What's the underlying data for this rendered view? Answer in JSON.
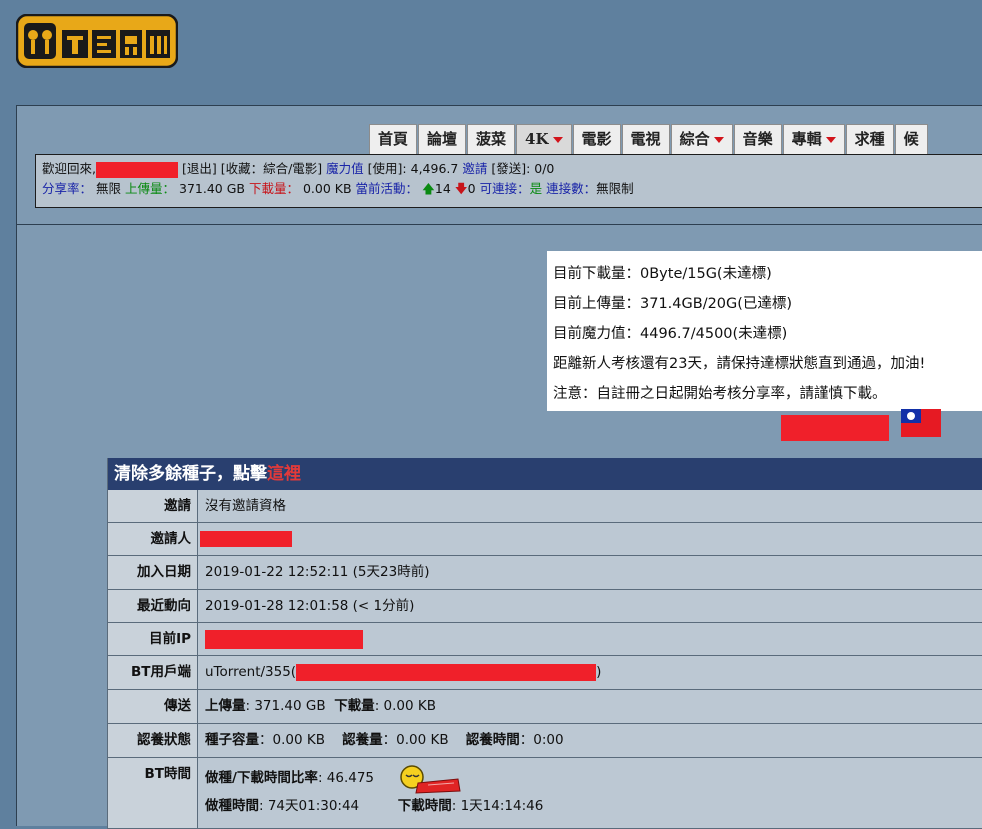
{
  "logo": {
    "alt_text": "MTEAM"
  },
  "nav": {
    "tabs": [
      {
        "label": "首頁",
        "dropdown": false
      },
      {
        "label": "論壇",
        "dropdown": false
      },
      {
        "label": "菠菜",
        "dropdown": false
      },
      {
        "label": "4K",
        "dropdown": true,
        "active": true
      },
      {
        "label": "電影",
        "dropdown": false
      },
      {
        "label": "電視",
        "dropdown": false
      },
      {
        "label": "綜合",
        "dropdown": true
      },
      {
        "label": "音樂",
        "dropdown": false
      },
      {
        "label": "專輯",
        "dropdown": true
      },
      {
        "label": "求種",
        "dropdown": false
      },
      {
        "label": "候",
        "dropdown": false
      }
    ]
  },
  "infobar": {
    "welcome": "歡迎回來,",
    "logout": "[退出]",
    "favorites": "[收藏：綜合/電影]",
    "bonus_label": "魔力值",
    "bonus_use": "[使用]: 4,496.7",
    "invite_label": "邀請",
    "invite_send": "[發送]: 0/0",
    "ratio_label": "分享率：",
    "ratio_value": "無限",
    "upload_label": "上傳量：",
    "upload_value": "371.40 GB",
    "download_label": "下載量：",
    "download_value": "0.00 KB",
    "active_label": "當前活動：",
    "seeding_count": "14",
    "leeching_count": "0",
    "connectable_label": "可連接：",
    "connectable_value": "是",
    "connections_label": "連接數：",
    "connections_value": "無限制"
  },
  "tip": {
    "lines": [
      "目前下載量：0Byte/15G(未達標)",
      "目前上傳量：371.4GB/20G(已達標)",
      "目前魔力值：4496.7/4500(未達標)",
      "距離新人考核還有23天，請保持達標狀態直到通過，加油!",
      "注意：自註冊之日起開始考核分享率，請謹慎下載。"
    ]
  },
  "table": {
    "header_text": "清除多餘種子，點擊",
    "header_link": "這裡",
    "rows": {
      "invite": {
        "label": "邀請",
        "value": "沒有邀請資格"
      },
      "inviter": {
        "label": "邀請人"
      },
      "join": {
        "label": "加入日期",
        "value": "2019-01-22 12:52:11 (5天23時前)"
      },
      "last": {
        "label": "最近動向",
        "value": "2019-01-28 12:01:58 (< 1分前)"
      },
      "ip": {
        "label": "目前IP"
      },
      "client": {
        "label": "BT用戶端",
        "prefix": "uTorrent/355(",
        "suffix": ")"
      },
      "transfer": {
        "label": "傳送",
        "up_label": "上傳量",
        "up_value": ": 371.40 GB",
        "down_label": "下載量",
        "down_value": ": 0.00 KB"
      },
      "status": {
        "label": "認養狀態",
        "seed_label": "種子容量",
        "seed_value": "：0.00 KB",
        "adopt_label": "認養量",
        "adopt_value": "：0.00 KB",
        "adopt_time_label": "認養時間",
        "adopt_time_value": "：0:00"
      },
      "bttime": {
        "label": "BT時間",
        "ratio_label": "做種/下載時間比率",
        "ratio_value": ": 46.475",
        "seed_time_label": "做種時間",
        "seed_time_value": ": 74天01:30:44",
        "dl_time_label": "下載時間",
        "dl_time_value": ": 1天14:14:46"
      }
    }
  },
  "colors": {
    "background": "#5f809e",
    "panel": "#7f9ab2",
    "header": "#293f6f",
    "redaction": "#f0202a"
  }
}
